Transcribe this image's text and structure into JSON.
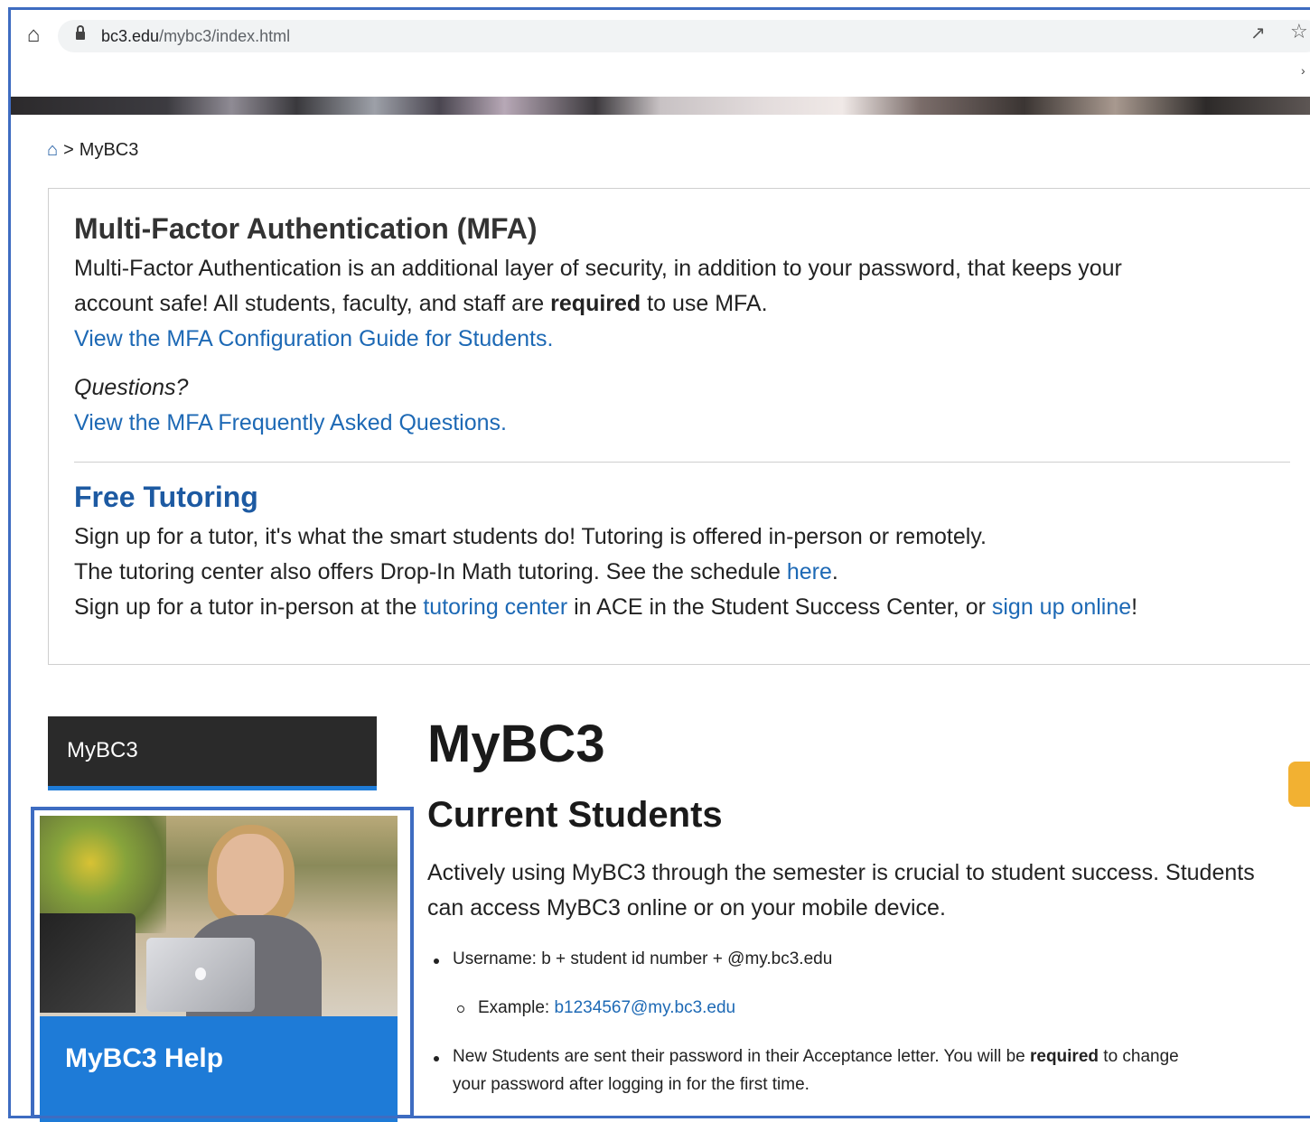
{
  "browser": {
    "url_domain": "bc3.edu",
    "url_path": "/mybc3/index.html",
    "home_icon": "home-icon",
    "share_icon": "share-icon",
    "star_icon": "star-icon"
  },
  "breadcrumb": {
    "home_icon": "home-icon",
    "separator": ">",
    "current": "MyBC3"
  },
  "mfa": {
    "title": "Multi-Factor Authentication (MFA)",
    "line1": "Multi-Factor Authentication is an additional layer of security, in addition to your password, that keeps your",
    "line2_prefix": "account safe! All students, faculty, and staff are ",
    "line2_bold": "required",
    "line2_suffix": " to use MFA.",
    "guide_link": "View the MFA Configuration Guide for Students.",
    "questions_label": "Questions?",
    "faq_link": "View the MFA Frequently Asked Questions."
  },
  "tutoring": {
    "title": "Free Tutoring",
    "line1": "Sign up for a tutor, it's what the smart students do! Tutoring is offered in-person or remotely.",
    "line2_prefix": "The tutoring center also offers Drop-In Math tutoring. See the schedule ",
    "line2_link": "here",
    "line2_suffix": ".",
    "line3_prefix": "Sign up for a tutor in-person at the ",
    "line3_link1": "tutoring center",
    "line3_middle": " in ACE in the Student Success Center, or ",
    "line3_link2": "sign up online",
    "line3_suffix": "!"
  },
  "sidebar": {
    "nav_label": "MyBC3",
    "help_label": "MyBC3 Help"
  },
  "main": {
    "title": "MyBC3",
    "subtitle": "Current Students",
    "intro": "Actively using MyBC3 through the semester is crucial to student success. Students can access MyBC3 online or on your mobile device.",
    "bullet1": "Username: b + student id number + @my.bc3.edu",
    "example_label": "Example: ",
    "example_link": "b1234567@my.bc3.edu",
    "bullet2_prefix": "New Students are sent their password in their Acceptance letter. You will be ",
    "bullet2_bold": "required",
    "bullet2_suffix": "  to change",
    "bullet2_line2": "your password after logging in for the first time."
  },
  "colors": {
    "link": "#1d69b5",
    "accent_blue": "#1e7bd7",
    "dark_nav": "#2a2a2a",
    "orange_tab": "#f2b132"
  }
}
